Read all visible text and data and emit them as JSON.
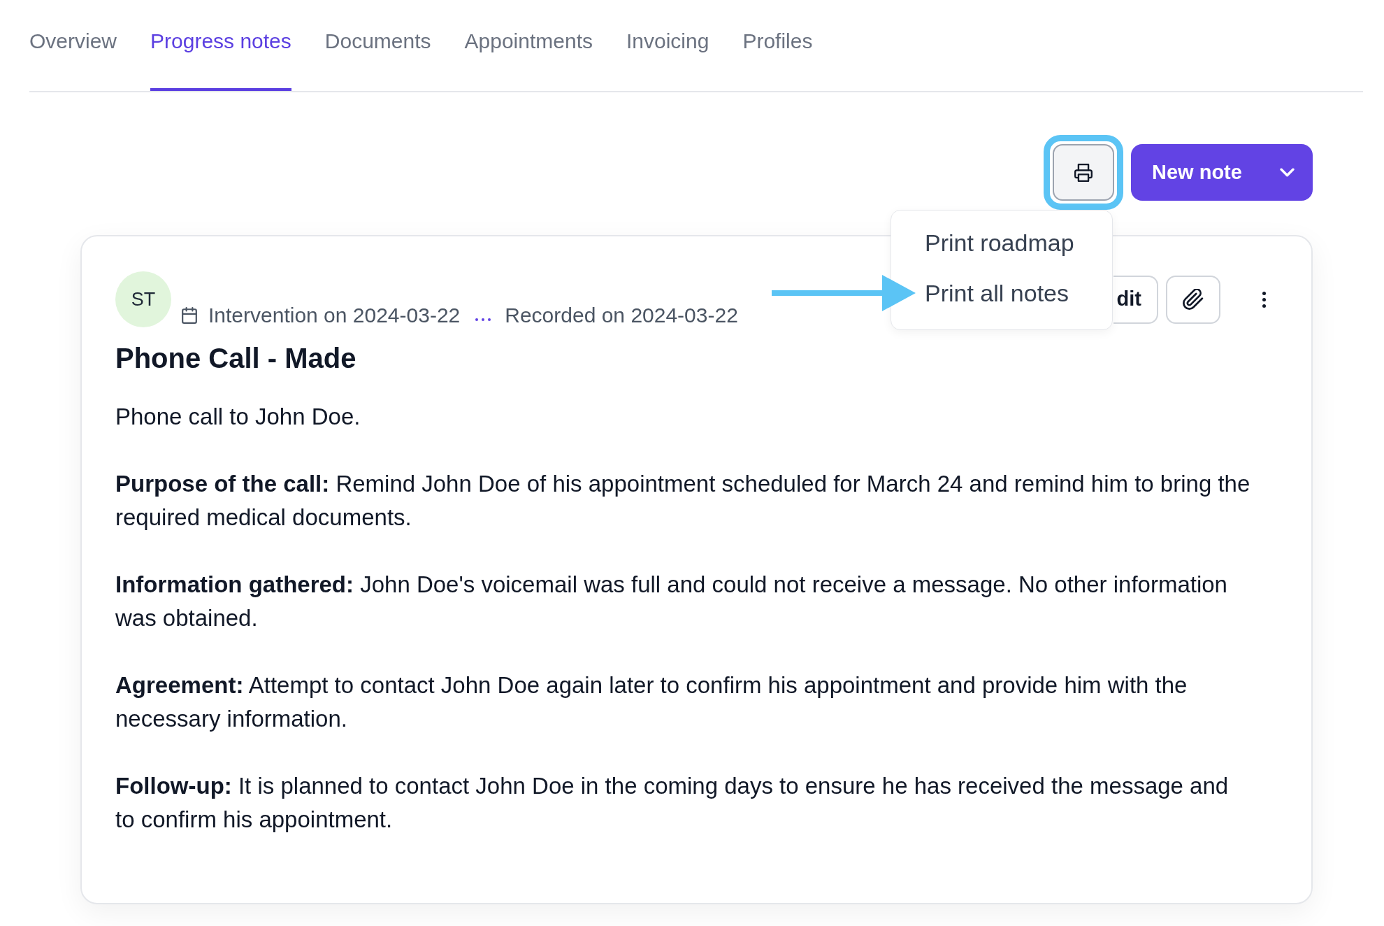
{
  "tabs": [
    {
      "label": "Overview",
      "selected": false
    },
    {
      "label": "Progress notes",
      "selected": true
    },
    {
      "label": "Documents",
      "selected": false
    },
    {
      "label": "Appointments",
      "selected": false
    },
    {
      "label": "Invoicing",
      "selected": false
    },
    {
      "label": "Profiles",
      "selected": false
    }
  ],
  "toolbar": {
    "print_button": {
      "highlighted": true,
      "expanded": true,
      "menu": [
        {
          "label": "Print roadmap",
          "highlighted": false
        },
        {
          "label": "Print all notes",
          "highlighted": true
        }
      ]
    },
    "new_note_button": {
      "label": "New note"
    }
  },
  "note": {
    "avatar": {
      "initials": "ST"
    },
    "intervention": "Intervention on 2024-03-22",
    "recorded": "Recorded on 2024-03-22",
    "edit_button": {
      "label": "dit"
    },
    "title": "Phone Call - Made",
    "paragraphs": [
      "Phone call to John Doe.",
      "**Purpose of the call:** Remind John Doe of his appointment scheduled for March 24 and remind him to bring the required medical documents.",
      "**Information gathered:** John Doe's voicemail was full and could not receive a message. No other information was obtained.",
      "**Agreement:** Attempt to contact John Doe again later to confirm his appointment and provide him with the necessary information.",
      "**Follow-up:** It is planned to contact John Doe in the coming days to ensure he has received the message and to confirm his appointment."
    ]
  }
}
